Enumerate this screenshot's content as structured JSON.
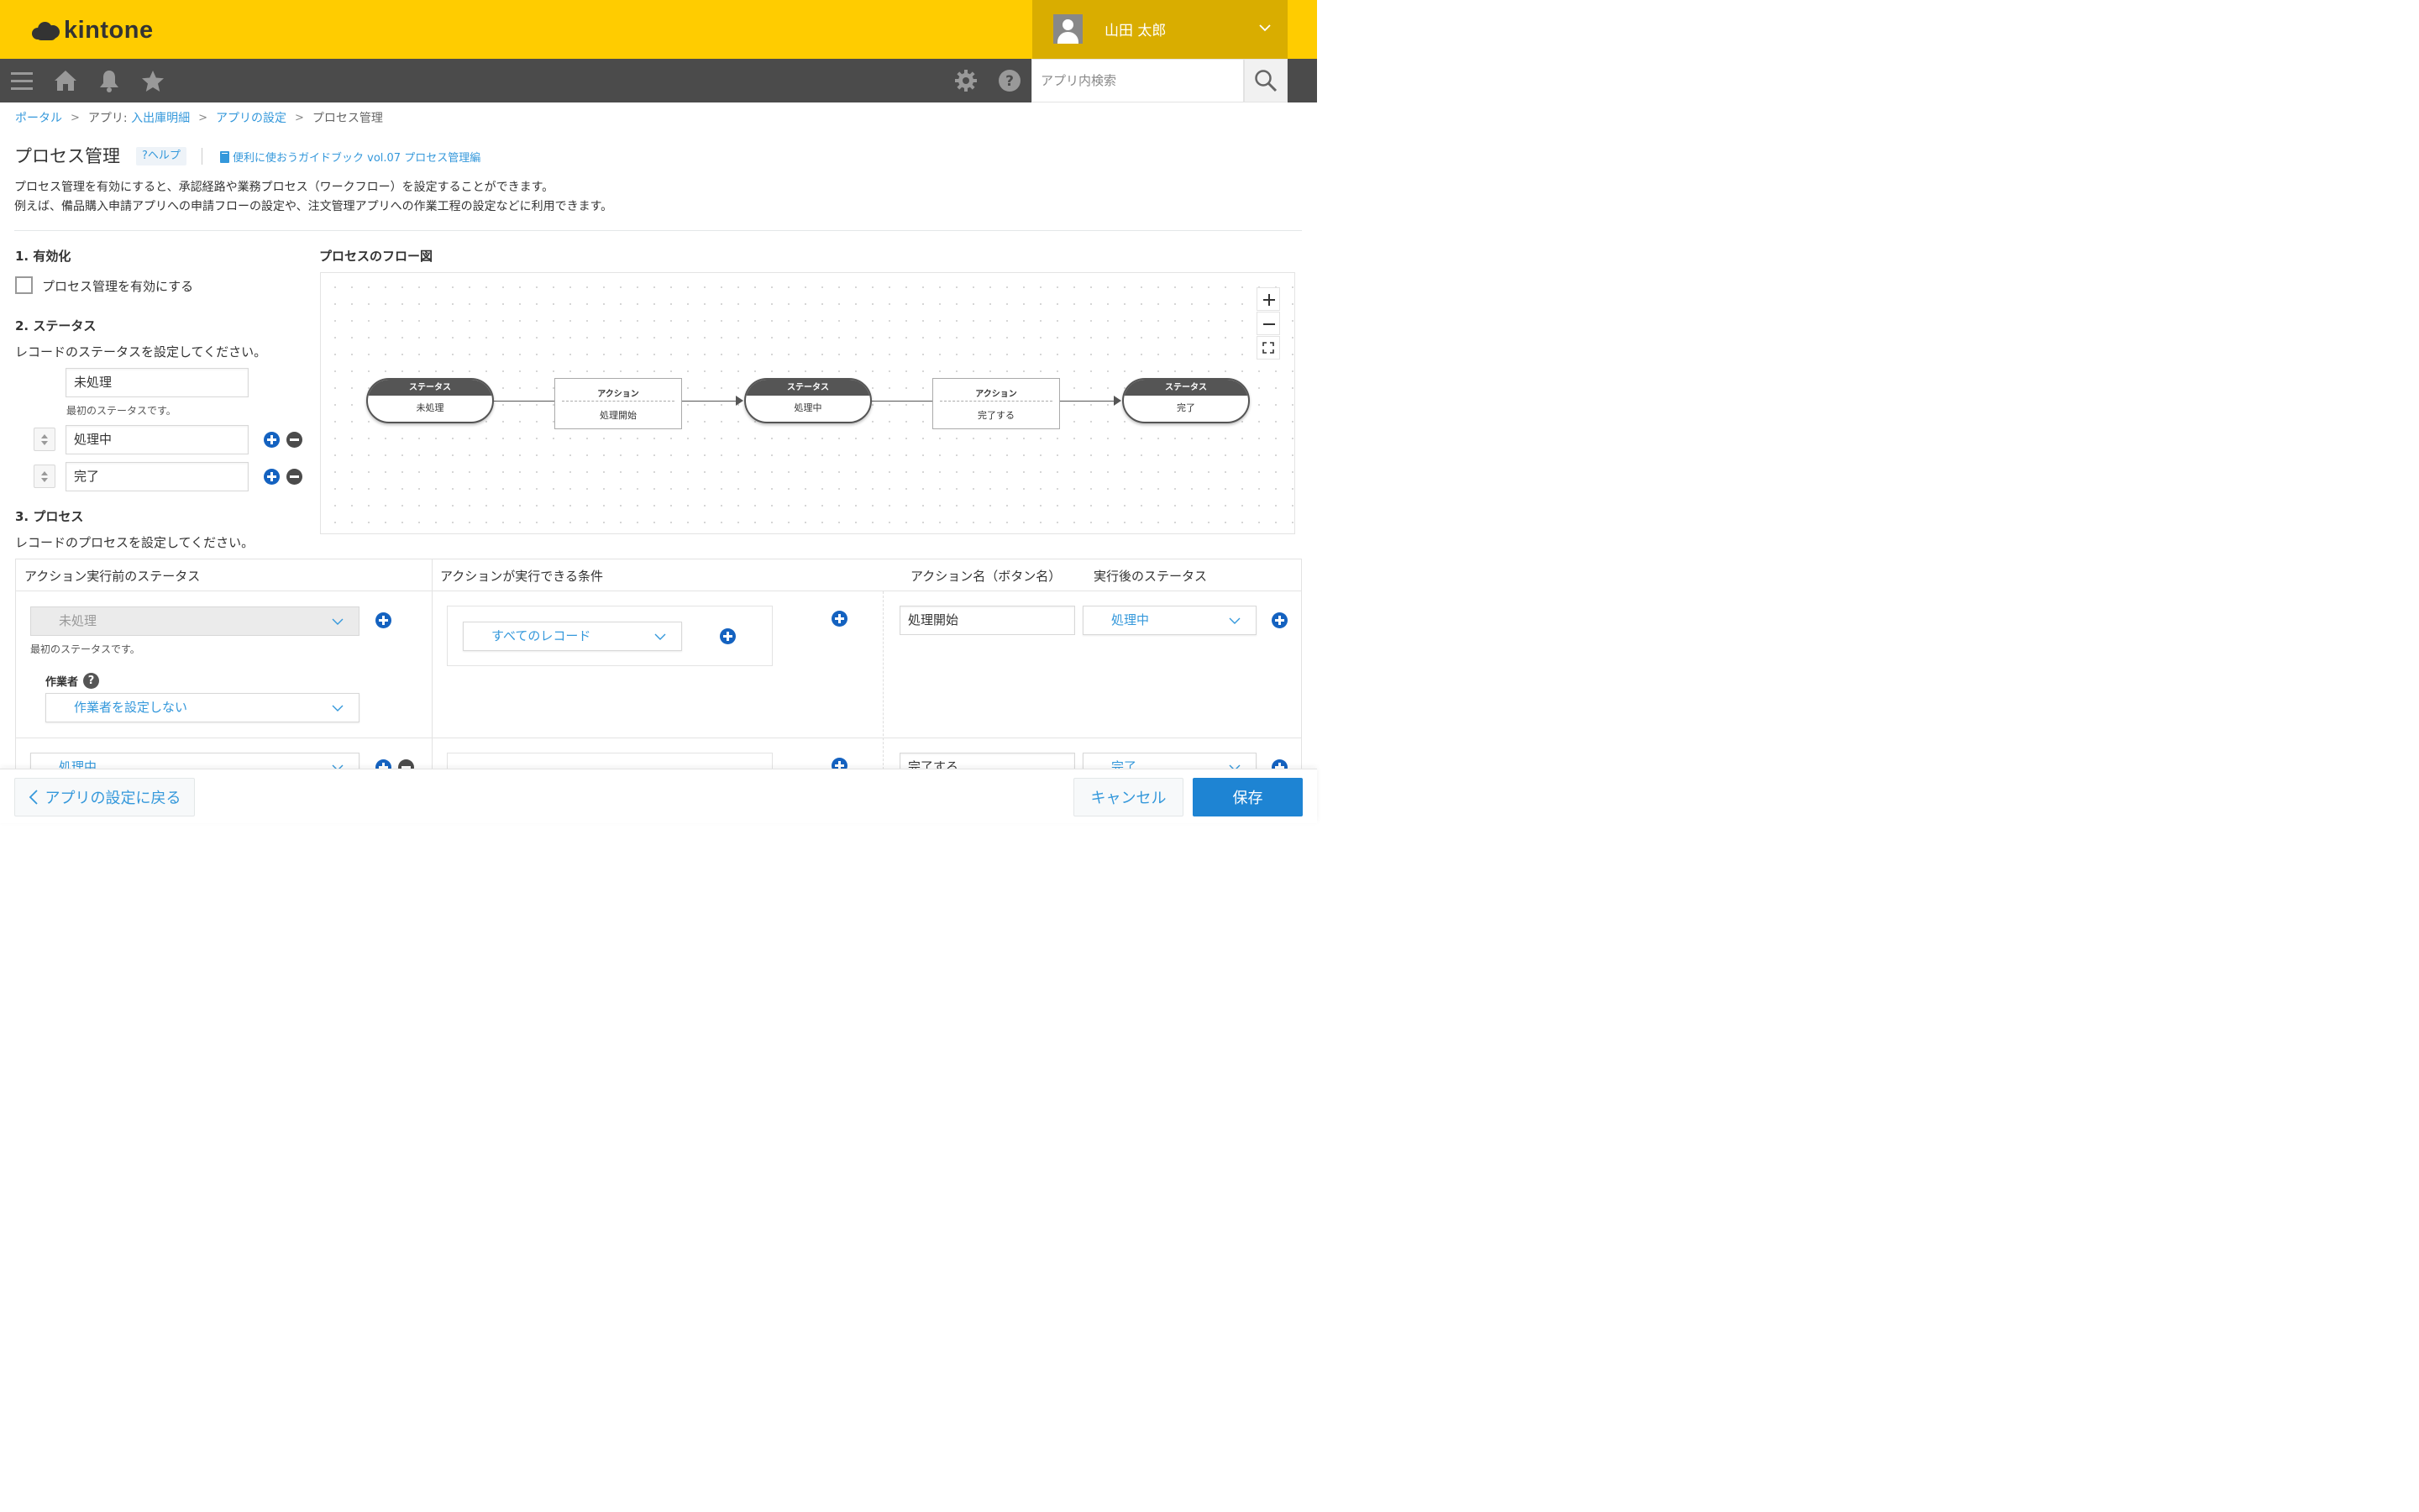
{
  "header": {
    "logo_text": "kintone",
    "user_name": "山田 太郎",
    "brand_color": "#ffcc00",
    "nav_color": "#4b4b4b"
  },
  "search": {
    "placeholder": "アプリ内検索"
  },
  "nav_icons": [
    "menu-icon",
    "home-icon",
    "bell-icon",
    "star-icon",
    "gear-icon",
    "help-icon",
    "search-icon"
  ],
  "breadcrumb": {
    "portal": "ポータル",
    "app_prefix": "アプリ: ",
    "app_name": "入出庫明細",
    "settings": "アプリの設定",
    "current": "プロセス管理",
    "sep": ">"
  },
  "page": {
    "title": "プロセス管理",
    "help": "?ヘルプ",
    "guide": "便利に使おうガイドブック vol.07 プロセス管理編",
    "desc_line1": "プロセス管理を有効にすると、承認経路や業務プロセス（ワークフロー）を設定することができます。",
    "desc_line2": "例えば、備品購入申請アプリへの申請フローの設定や、注文管理アプリへの作業工程の設定などに利用できます。"
  },
  "section1": {
    "heading": "1. 有効化",
    "checkbox_label": "プロセス管理を有効にする",
    "checked": false
  },
  "section2": {
    "heading": "2. ステータス",
    "instruction": "レコードのステータスを設定してください。",
    "statuses": [
      "未処理",
      "処理中",
      "完了"
    ],
    "first_note": "最初のステータスです。"
  },
  "section3": {
    "heading": "3. プロセス",
    "instruction": "レコードのプロセスを設定してください。"
  },
  "flow": {
    "title": "プロセスのフロー図",
    "status_header": "ステータス",
    "action_header": "アクション",
    "nodes": [
      {
        "type": "status",
        "label": "未処理"
      },
      {
        "type": "action",
        "label": "処理開始"
      },
      {
        "type": "status",
        "label": "処理中"
      },
      {
        "type": "action",
        "label": "完了する"
      },
      {
        "type": "status",
        "label": "完了"
      }
    ]
  },
  "process_table": {
    "headers": {
      "before": "アクション実行前のステータス",
      "condition": "アクションが実行できる条件",
      "action_name": "アクション名（ボタン名）",
      "after": "実行後のステータス"
    },
    "assignee_label": "作業者",
    "rows": [
      {
        "before": "未処理",
        "note": "最初のステータスです。",
        "assignee": "作業者を設定しない",
        "condition": "すべてのレコード",
        "action": "処理開始",
        "after": "処理中"
      },
      {
        "before": "処理中",
        "action": "完了する",
        "after": "完了"
      }
    ]
  },
  "footer": {
    "back": "アプリの設定に戻る",
    "cancel": "キャンセル",
    "save": "保存"
  }
}
